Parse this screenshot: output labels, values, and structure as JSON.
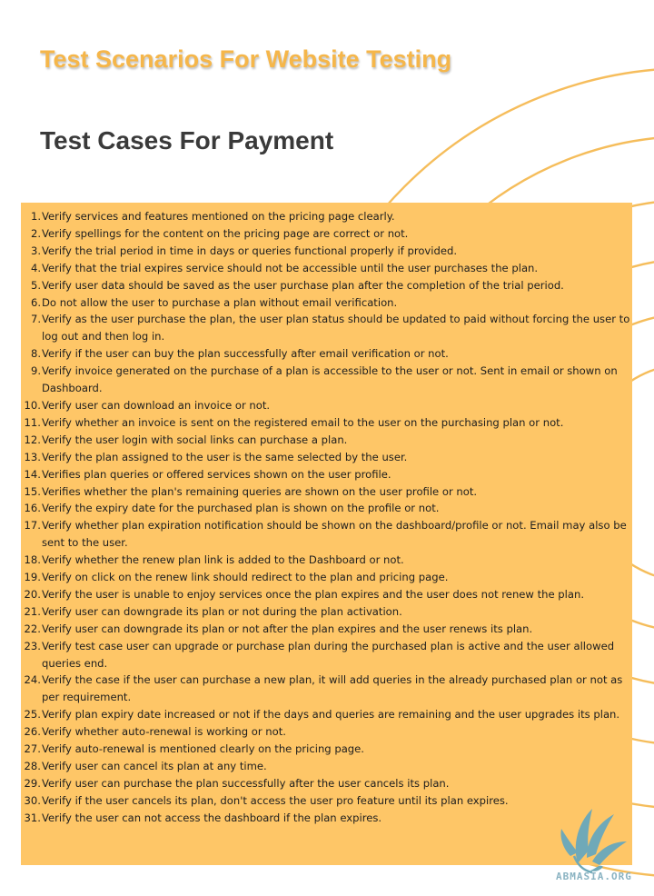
{
  "header": {
    "title": "Test Scenarios For Website Testing",
    "subtitle": "Test Cases For Payment"
  },
  "test_cases": [
    {
      "num": "1.",
      "text": "Verify services and features mentioned on the pricing page clearly."
    },
    {
      "num": "2.",
      "text": "Verify spellings for the content on the pricing page are correct or not."
    },
    {
      "num": "3.",
      "text": "Verify the trial period in time in days or queries functional properly if provided."
    },
    {
      "num": "4.",
      "text": "Verify that the trial expires service should not be accessible until the user purchases the plan."
    },
    {
      "num": "5.",
      "text": "Verify user data should be saved as the user purchase plan after the completion of the trial period."
    },
    {
      "num": "6.",
      "text": "Do not allow the user to purchase a plan without email verification."
    },
    {
      "num": "7.",
      "text": "Verify as the user purchase the plan, the user plan status should be updated to paid without forcing the user to log out and then log in."
    },
    {
      "num": "8.",
      "text": "Verify if the user can buy the plan successfully after email verification or not."
    },
    {
      "num": "9.",
      "text": "Verify invoice generated on the purchase of a plan is accessible to the user or not. Sent in email or shown on Dashboard."
    },
    {
      "num": "10.",
      "text": "Verify user can download an invoice or not."
    },
    {
      "num": "11.",
      "text": "Verify whether an invoice is sent on the registered email to the user on the purchasing plan or not."
    },
    {
      "num": "12.",
      "text": "Verify the user login with social links can purchase a plan."
    },
    {
      "num": "13.",
      "text": "Verify the plan assigned to the user is the same selected by the user."
    },
    {
      "num": "14.",
      "text": "Verifies plan queries or offered services shown on the user profile."
    },
    {
      "num": "15.",
      "text": "Verifies whether the plan's remaining queries are shown on the user profile or not."
    },
    {
      "num": "16.",
      "text": "Verify the expiry date for the purchased plan is shown on the profile or not."
    },
    {
      "num": "17.",
      "text": "Verify whether plan expiration notification should be shown on the dashboard/profile or not. Email may also be sent to the user."
    },
    {
      "num": "18.",
      "text": "Verify whether the renew plan link is added to the Dashboard or not."
    },
    {
      "num": "19.",
      "text": "Verify on click on the renew link should redirect to the plan and pricing page."
    },
    {
      "num": "20.",
      "text": "Verify the user is unable to enjoy services once the plan expires and the user does not renew the plan."
    },
    {
      "num": "21.",
      "text": "Verify user can downgrade its plan or not during the plan activation."
    },
    {
      "num": "22.",
      "text": "Verify user can downgrade its plan or not after the plan expires and the user renews its plan."
    },
    {
      "num": "23.",
      "text": "Verify test case user can upgrade or purchase plan during the purchased plan is active and the user allowed queries end."
    },
    {
      "num": "24.",
      "text": "Verify the case if the user can purchase a new plan, it will add queries in the already purchased plan or not as per requirement."
    },
    {
      "num": "25.",
      "text": "Verify plan expiry date increased or not if the days and queries are remaining and the user upgrades its plan."
    },
    {
      "num": "26.",
      "text": "Verify whether auto-renewal is working or not."
    },
    {
      "num": "27.",
      "text": "Verify auto-renewal is mentioned clearly on the pricing page."
    },
    {
      "num": "28.",
      "text": "Verify user can cancel its plan at any time."
    },
    {
      "num": "29.",
      "text": "Verify user can purchase the plan successfully after the user cancels its plan."
    },
    {
      "num": "30.",
      "text": "Verify if the user cancels its plan, don't access the user pro feature until its plan expires."
    },
    {
      "num": "31.",
      "text": "Verify the user can not access the dashboard if the plan expires."
    }
  ],
  "logo": {
    "text": "ABMASIA.ORG",
    "icon": "feather-pen-icon"
  },
  "colors": {
    "accent": "#f5b64a",
    "panel": "#fec667",
    "title_dark": "#3a3a3a",
    "logo_blue": "#6fa9b8"
  }
}
